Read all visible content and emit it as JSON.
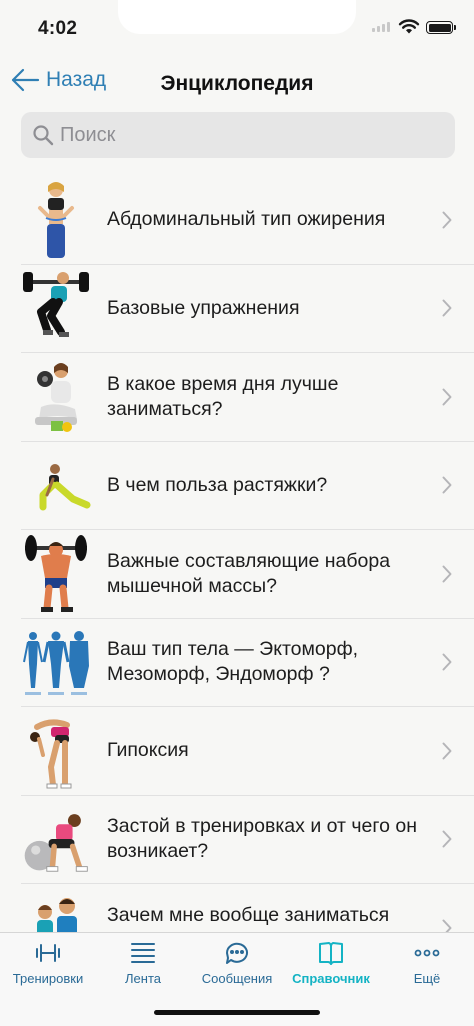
{
  "status_bar": {
    "time": "4:02"
  },
  "nav": {
    "back_label": "Назад",
    "title": "Энциклопедия"
  },
  "search": {
    "placeholder": "Поиск"
  },
  "list": {
    "items": [
      {
        "label": "Абдоминальный тип ожирения",
        "icon": "woman-measuring-waist"
      },
      {
        "label": "Базовые упражнения",
        "icon": "woman-barbell-squat"
      },
      {
        "label": "В какое время дня лучше заниматься?",
        "icon": "woman-dumbbells"
      },
      {
        "label": "В чем польза растяжки?",
        "icon": "woman-lunge-stretch"
      },
      {
        "label": "Важные составляющие набора мышечной массы?",
        "icon": "bodybuilder-barbell"
      },
      {
        "label": "Ваш тип тела — Эктоморф, Мезоморф, Эндоморф ?",
        "icon": "body-types"
      },
      {
        "label": "Гипоксия",
        "icon": "woman-bent-over"
      },
      {
        "label": "Застой в тренировках и от чего он возникает?",
        "icon": "woman-fitball"
      },
      {
        "label": "Зачем мне вообще заниматься спортом, я и так молод и",
        "icon": "couple-fitness"
      }
    ]
  },
  "tabs": [
    {
      "label": "Тренировки",
      "icon": "dumbbell-icon"
    },
    {
      "label": "Лента",
      "icon": "feed-lines-icon"
    },
    {
      "label": "Сообщения",
      "icon": "chat-bubbles-icon"
    },
    {
      "label": "Справочник",
      "icon": "book-icon",
      "active": true
    },
    {
      "label": "Ещё",
      "icon": "more-dots-icon"
    }
  ],
  "colors": {
    "accent": "#2f7fb4",
    "active_tab": "#14b3c4",
    "background": "#f7f7f5"
  }
}
